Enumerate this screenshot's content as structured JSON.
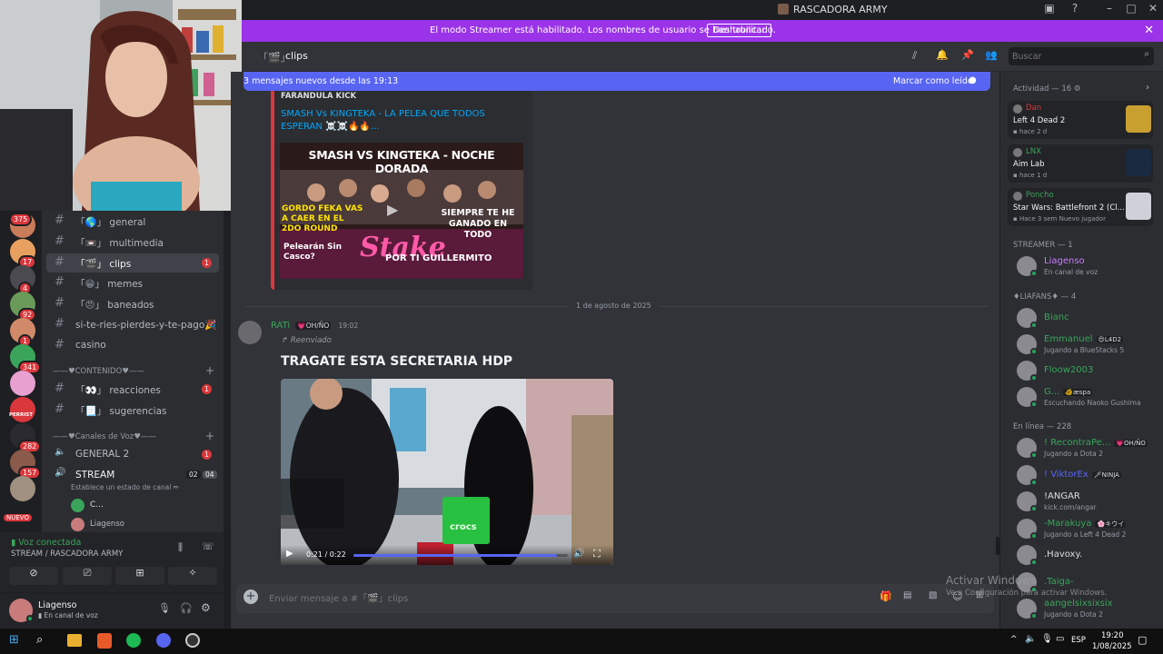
{
  "window": {
    "title": "RASCADORA ARMY"
  },
  "banner": {
    "text": "El modo Streamer está habilitado. Los nombres de usuario se han truncado.",
    "button": "Deshabilitar"
  },
  "header": {
    "channel": "clips",
    "search_placeholder": "Buscar"
  },
  "newbar": {
    "text": "3 mensajes nuevos desde las 19:13",
    "mark_read": "Marcar como leído"
  },
  "servers": [
    {
      "badge": "375",
      "color": "#c97b5a"
    },
    {
      "badge": "17",
      "color": "#e8a060"
    },
    {
      "badge": "4",
      "color": "#4a4a50"
    },
    {
      "badge": "92",
      "color": "#6a9a5a"
    },
    {
      "badge": "1",
      "color": "#d08a6a"
    },
    {
      "badge": "341",
      "color": "#3aa55a"
    },
    {
      "badge": "",
      "color": "#e8a0d0"
    },
    {
      "badge": "",
      "color": "#da373c"
    },
    {
      "badge": "282",
      "color": "#2a2a30"
    },
    {
      "badge": "157",
      "color": "#8a5a4a"
    },
    {
      "badge": "",
      "color": "#a09080"
    }
  ],
  "rail_labels": {
    "nuevo": "NUEVO",
    "perrist": "PERRIST"
  },
  "channels": [
    {
      "emoji": "🌎",
      "name": "general",
      "unread": ""
    },
    {
      "emoji": "📼",
      "name": "multimedia",
      "unread": ""
    },
    {
      "emoji": "🎬",
      "name": "clips",
      "unread": "1"
    },
    {
      "emoji": "😁",
      "name": "memes",
      "unread": ""
    },
    {
      "emoji": "😠",
      "name": "baneados",
      "unread": ""
    },
    {
      "emoji": "",
      "name": "si-te-ries-pierdes-y-te-pago🎉",
      "unread": ""
    },
    {
      "emoji": "",
      "name": "casino",
      "unread": ""
    }
  ],
  "categories": {
    "contenido": "——♥CONTENIDO♥——",
    "voz": "——♥Canales de Voz♥——"
  },
  "content_channels": [
    {
      "emoji": "👀",
      "name": "reacciones",
      "unread": "1"
    },
    {
      "emoji": "📃",
      "name": "sugerencias",
      "unread": ""
    }
  ],
  "voice_channels": [
    {
      "name": "GENERAL 2",
      "unread": "1"
    },
    {
      "name": "STREAM",
      "count_a": "02",
      "count_b": "04"
    }
  ],
  "stream_status": "Establece un estado de canal ✏",
  "voice_users": [
    {
      "name": "C..."
    },
    {
      "name": "Liagenso"
    }
  ],
  "voice_panel": {
    "status": "Voz conectada",
    "location": "STREAM / RASCADORA ARMY"
  },
  "user": {
    "name": "Liagenso",
    "status": "En canal de voz"
  },
  "messages": {
    "embed": {
      "provider": "FARANDULA KICK",
      "title": "SMASH Vs KINGTEKA - LA PELEA QUE TODOS ESPERAN ☠️☠️🔥🔥...",
      "thumb": {
        "headline": "SMASH VS KINGTEKA - NOCHE DORADA",
        "left": "GORDO FEKA VAS A CAER EN EL 2DO ROUND",
        "right": "SIEMPRE TE HE GANADO EN TODO",
        "bottom_left": "Pelearán Sin Casco?",
        "brand": "Stake",
        "bottom_right": "POR TI GUILLERMITO"
      }
    },
    "divider": "1 de agosto de 2025",
    "post": {
      "author": "RATi",
      "author_tag": "💗OH/ÑO",
      "time": "19:02",
      "forwarded": "Reenviado",
      "title": "TRAGATE ESTA SECRETARIA HDP",
      "video": {
        "time": "0:21 / 0:22",
        "progress": 0.95,
        "bag_text": "crocs"
      }
    }
  },
  "composer": {
    "placeholder": "Enviar mensaje a #「🎬」clips"
  },
  "members": {
    "activity_header": "Actividad — 16",
    "activity": [
      {
        "name": "Dan",
        "game": "Left 4 Dead 2",
        "time": "hace 2 d",
        "color": "#da373c",
        "thumb": "#c8a030"
      },
      {
        "name": "LNX",
        "game": "Aim Lab",
        "time": "hace 1 d",
        "color": "#3aa55a",
        "thumb": "#1a2a40"
      },
      {
        "name": "Poncho",
        "game": "Star Wars: Battlefront 2 (Cl...",
        "time": "Hace 3 sem",
        "extra": "Nuevo jugador",
        "color": "#3aa55a",
        "thumb": "#d0d0d8"
      }
    ],
    "streamer_header": "STREAMER — 1",
    "streamer": [
      {
        "name": "Liagenso",
        "status": "En canal de voz",
        "color": "#c77dff"
      }
    ],
    "liafans_header": "♦LIAFANS♦ — 4",
    "liafans": [
      {
        "name": "Bianc",
        "status": "",
        "tag": "",
        "color": "#3aa55a"
      },
      {
        "name": "Emmanuel",
        "status": "Jugando a BlueStacks 5",
        "tag": "😍L4D2",
        "color": "#3aa55a"
      },
      {
        "name": "Floow2003",
        "status": "",
        "tag": "",
        "color": "#3aa55a"
      },
      {
        "name": "G...",
        "status": "Escuchando Naoko Gushima",
        "tag": "🐠æspa",
        "color": "#3aa55a"
      }
    ],
    "online_header": "En línea — 228",
    "online": [
      {
        "name": "! RecontraPe...",
        "status": "Jugando a Dota 2",
        "tag": "💗OH/ÑO",
        "color": "#3aa55a"
      },
      {
        "name": "! ViktorEx",
        "status": "",
        "tag": "🗡NINJA",
        "color": "#5865f2"
      },
      {
        "name": "!ANGAR",
        "status": "kick.com/angar",
        "tag": "",
        "color": "#dbdee1"
      },
      {
        "name": "-Marakuya",
        "status": "Jugando a Left 4 Dead 2",
        "tag": "🌸キウイ",
        "color": "#3aa55a"
      },
      {
        "name": ".Havoxy.",
        "status": "",
        "tag": "",
        "color": "#dbdee1"
      },
      {
        "name": ".Taiga-",
        "status": "",
        "tag": "",
        "color": "#3aa55a"
      },
      {
        "name": "aangelsixsixsix",
        "status": "Jugando a Dota 2",
        "tag": "",
        "color": "#3aa55a"
      }
    ]
  },
  "watermark": {
    "line1": "Activar Windows",
    "line2": "Ve a Configuración para activar Windows."
  },
  "taskbar": {
    "lang": "ESP",
    "time": "19:20",
    "date": "1/08/2025"
  }
}
